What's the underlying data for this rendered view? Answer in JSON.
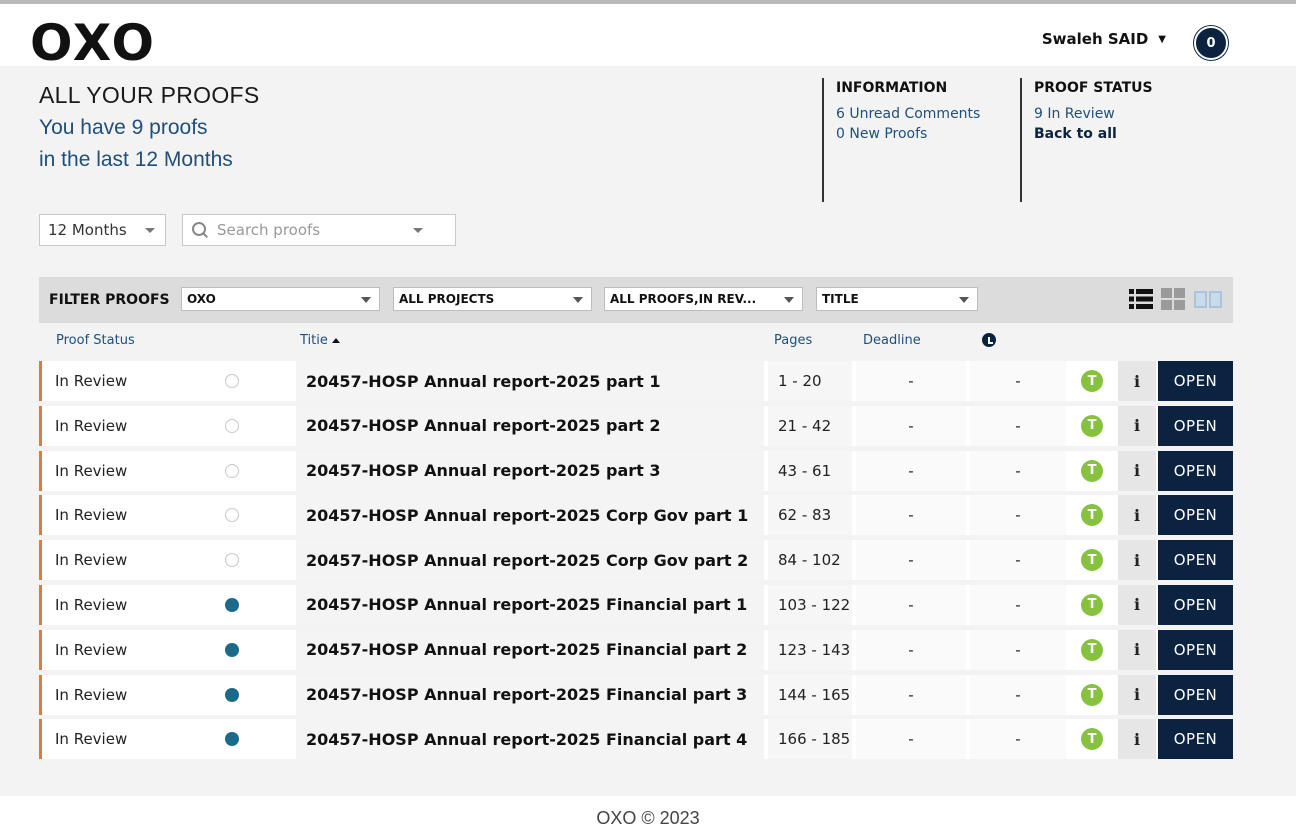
{
  "header": {
    "logo": "OXO",
    "user_name": "Swaleh SAID",
    "avatar_count": "0"
  },
  "summary": {
    "title": "ALL YOUR PROOFS",
    "line1": "You have 9 proofs",
    "line2": "in the last 12 Months"
  },
  "information": {
    "heading": "INFORMATION",
    "unread_comments": "6 Unread Comments",
    "new_proofs": "0 New Proofs"
  },
  "proof_status": {
    "heading": "PROOF STATUS",
    "in_review": "9 In Review",
    "back_link": "Back to all"
  },
  "controls": {
    "period_value": "12 Months",
    "search_placeholder": "Search proofs"
  },
  "filters": {
    "label": "FILTER PROOFS",
    "client": "OXO",
    "projects": "ALL PROJECTS",
    "proofs": "ALL PROOFS,IN REV...",
    "sort": "TITLE"
  },
  "columns": {
    "status": "Proof Status",
    "title": "Titie",
    "pages": "Pages",
    "deadline": "Deadline"
  },
  "rows": [
    {
      "status": "In Review",
      "read": true,
      "title": "20457-HOSP Annual report-2025 part 1",
      "pages": "1 - 20",
      "deadline": "-",
      "alarm": "-",
      "t": "T",
      "info": "i",
      "open": "OPEN"
    },
    {
      "status": "In Review",
      "read": true,
      "title": "20457-HOSP Annual report-2025 part 2",
      "pages": "21 - 42",
      "deadline": "-",
      "alarm": "-",
      "t": "T",
      "info": "i",
      "open": "OPEN"
    },
    {
      "status": "In Review",
      "read": true,
      "title": "20457-HOSP Annual report-2025 part 3",
      "pages": "43 - 61",
      "deadline": "-",
      "alarm": "-",
      "t": "T",
      "info": "i",
      "open": "OPEN"
    },
    {
      "status": "In Review",
      "read": true,
      "title": "20457-HOSP Annual report-2025 Corp Gov part 1",
      "pages": "62 - 83",
      "deadline": "-",
      "alarm": "-",
      "t": "T",
      "info": "i",
      "open": "OPEN"
    },
    {
      "status": "In Review",
      "read": true,
      "title": "20457-HOSP Annual report-2025 Corp Gov part 2",
      "pages": "84 - 102",
      "deadline": "-",
      "alarm": "-",
      "t": "T",
      "info": "i",
      "open": "OPEN"
    },
    {
      "status": "In Review",
      "read": false,
      "title": "20457-HOSP Annual report-2025 Financial part 1",
      "pages": "103 - 122",
      "deadline": "-",
      "alarm": "-",
      "t": "T",
      "info": "i",
      "open": "OPEN"
    },
    {
      "status": "In Review",
      "read": false,
      "title": "20457-HOSP Annual report-2025 Financial part 2",
      "pages": "123 - 143",
      "deadline": "-",
      "alarm": "-",
      "t": "T",
      "info": "i",
      "open": "OPEN"
    },
    {
      "status": "In Review",
      "read": false,
      "title": "20457-HOSP Annual report-2025 Financial part 3",
      "pages": "144 - 165",
      "deadline": "-",
      "alarm": "-",
      "t": "T",
      "info": "i",
      "open": "OPEN"
    },
    {
      "status": "In Review",
      "read": false,
      "title": "20457-HOSP Annual report-2025 Financial part 4",
      "pages": "166 - 185",
      "deadline": "-",
      "alarm": "-",
      "t": "T",
      "info": "i",
      "open": "OPEN"
    }
  ],
  "footer": {
    "text": "OXO © 2023"
  },
  "colors": {
    "navy": "#0b2340",
    "accent_blue": "#1f4f7a",
    "status_orange": "#e07a3a",
    "unread_dot": "#1c6a8a",
    "t_badge_green": "#86c23f"
  }
}
